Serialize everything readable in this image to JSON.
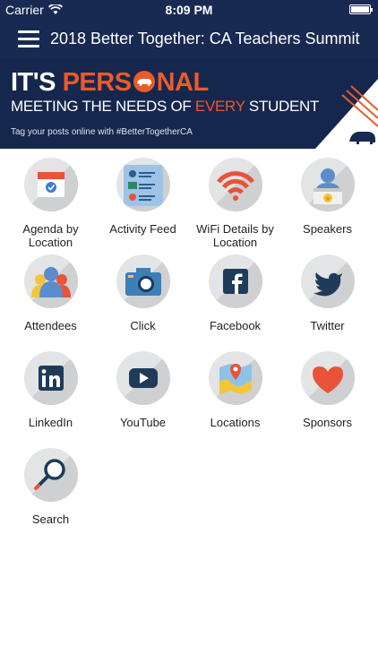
{
  "status_bar": {
    "carrier": "Carrier",
    "time": "8:09 PM"
  },
  "nav": {
    "title": "2018 Better Together: CA Teachers Summit"
  },
  "banner": {
    "title_pre": "IT'S ",
    "title_accent": "PERS",
    "title_post": "NAL",
    "sub_pre": "MEETING THE NEEDS OF ",
    "sub_accent": "EVERY",
    "sub_post": " STUDENT",
    "tagline": "Tag your posts online with #BetterTogetherCA"
  },
  "tiles": [
    {
      "label": "Agenda by\nLocation",
      "icon": "calendar-icon"
    },
    {
      "label": "Activity Feed",
      "icon": "activity-feed-icon"
    },
    {
      "label": "WiFi Details by\nLocation",
      "icon": "wifi-icon"
    },
    {
      "label": "Speakers",
      "icon": "speaker-icon"
    },
    {
      "label": "Attendees",
      "icon": "attendees-icon"
    },
    {
      "label": "Click",
      "icon": "camera-icon"
    },
    {
      "label": "Facebook",
      "icon": "facebook-icon"
    },
    {
      "label": "Twitter",
      "icon": "twitter-icon"
    },
    {
      "label": "LinkedIn",
      "icon": "linkedin-icon"
    },
    {
      "label": "YouTube",
      "icon": "youtube-icon"
    },
    {
      "label": "Locations",
      "icon": "map-icon"
    },
    {
      "label": "Sponsors",
      "icon": "heart-icon"
    },
    {
      "label": "Search",
      "icon": "search-icon"
    }
  ],
  "colors": {
    "nav": "#182a52",
    "accent": "#ea5a2b"
  }
}
